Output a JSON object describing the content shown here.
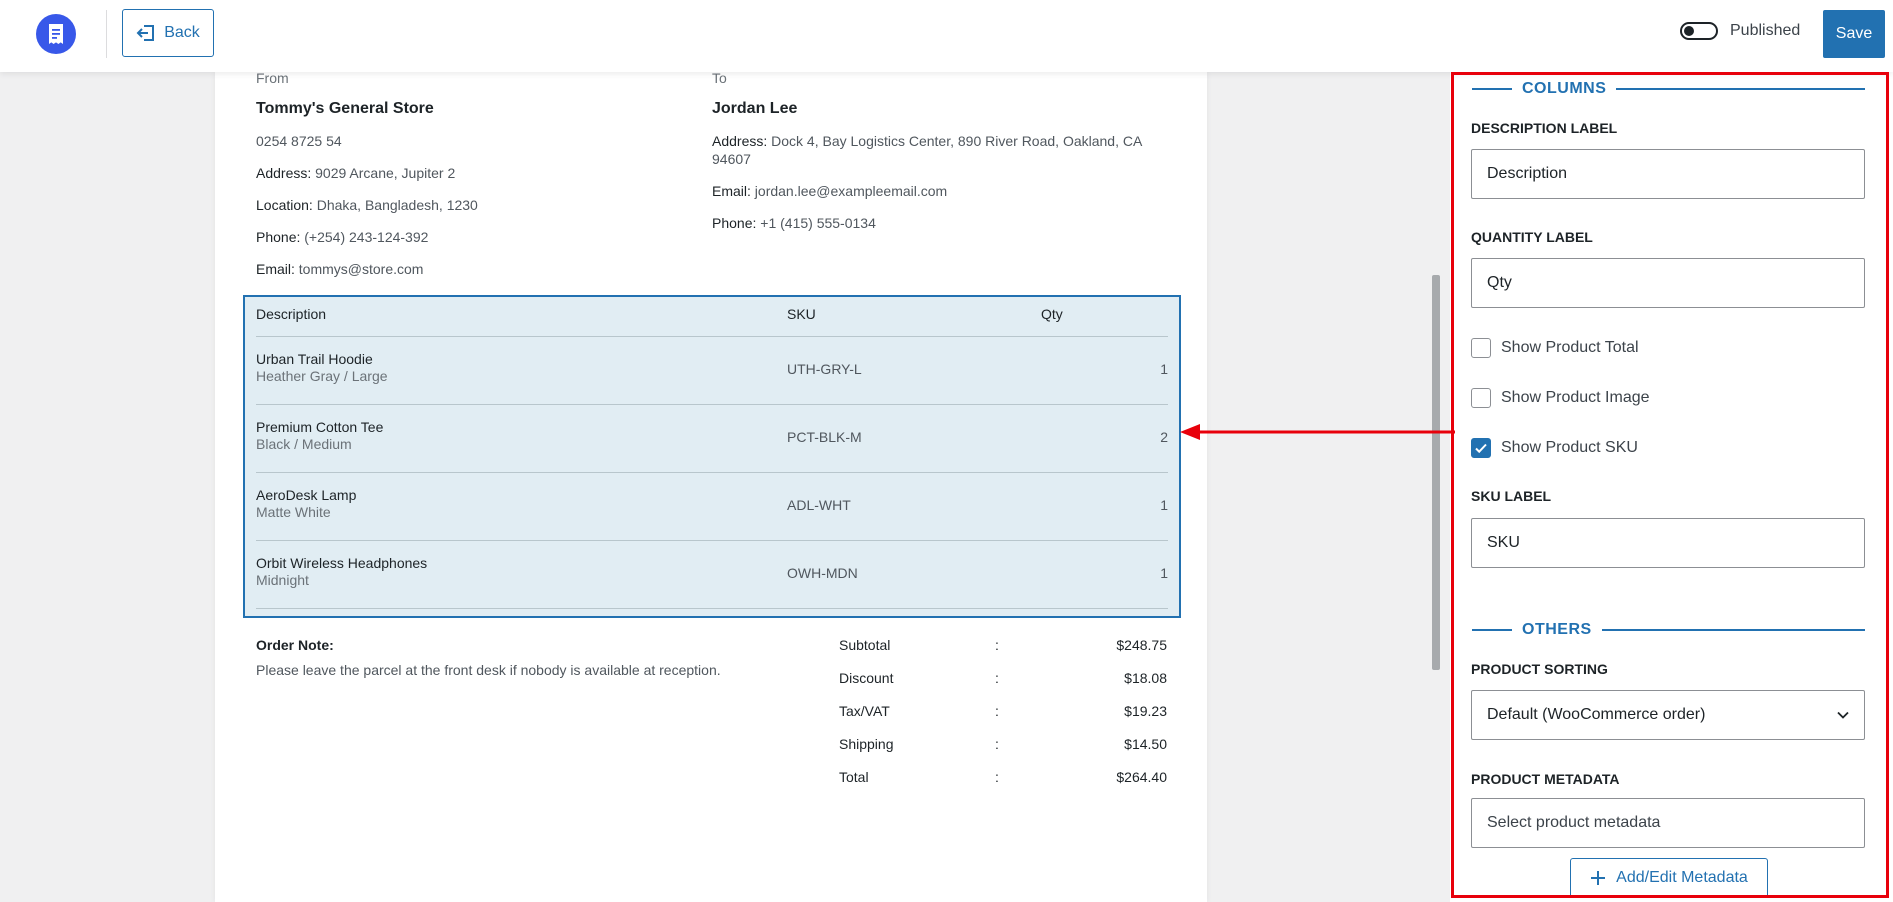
{
  "header": {
    "back_label": "Back",
    "published_label": "Published",
    "published_on": false,
    "save_label": "Save"
  },
  "invoice": {
    "from": {
      "label": "From",
      "name": "Tommy's General Store",
      "phone_plain": "0254 8725 54",
      "address_key": "Address:",
      "address": " 9029 Arcane, Jupiter 2",
      "location_key": "Location:",
      "location": " Dhaka, Bangladesh, 1230",
      "phone_key": "Phone:",
      "phone": " (+254) 243-124-392",
      "email_key": "Email:",
      "email": " tommys@store.com"
    },
    "to": {
      "label": "To",
      "name": "Jordan Lee",
      "address_key": "Address:",
      "address": " Dock 4, Bay Logistics Center, 890 River Road, Oakland, CA 94607",
      "email_key": "Email:",
      "email": " jordan.lee@exampleemail.com",
      "phone_key": "Phone:",
      "phone": " +1 (415) 555-0134"
    },
    "columns": [
      "Description",
      "SKU",
      "Qty"
    ],
    "items": [
      {
        "name": "Urban Trail Hoodie",
        "variant": "Heather Gray / Large",
        "sku": "UTH-GRY-L",
        "qty": "1"
      },
      {
        "name": "Premium Cotton Tee",
        "variant": "Black / Medium",
        "sku": "PCT-BLK-M",
        "qty": "2"
      },
      {
        "name": "AeroDesk Lamp",
        "variant": "Matte White",
        "sku": "ADL-WHT",
        "qty": "1"
      },
      {
        "name": "Orbit Wireless Headphones",
        "variant": "Midnight",
        "sku": "OWH-MDN",
        "qty": "1"
      }
    ],
    "note_title": "Order Note:",
    "note_text": "Please leave the parcel at the front desk if nobody is available at reception.",
    "totals": [
      {
        "label": "Subtotal",
        "sep": ":",
        "value": "$248.75"
      },
      {
        "label": "Discount",
        "sep": ":",
        "value": "$18.08"
      },
      {
        "label": "Tax/VAT",
        "sep": ":",
        "value": "$19.23"
      },
      {
        "label": "Shipping",
        "sep": ":",
        "value": "$14.50"
      },
      {
        "label": "Total",
        "sep": ":",
        "value": "$264.40"
      }
    ]
  },
  "panel": {
    "columns_title": "COLUMNS",
    "description_label_title": "DESCRIPTION LABEL",
    "description_label_value": "Description",
    "quantity_label_title": "QUANTITY LABEL",
    "quantity_label_value": "Qty",
    "show_total_label": "Show Product Total",
    "show_total_checked": false,
    "show_image_label": "Show Product Image",
    "show_image_checked": false,
    "show_sku_label": "Show Product SKU",
    "show_sku_checked": true,
    "sku_label_title": "SKU LABEL",
    "sku_label_value": "SKU",
    "others_title": "OTHERS",
    "sorting_title": "PRODUCT SORTING",
    "sorting_value": "Default (WooCommerce order)",
    "metadata_title": "PRODUCT METADATA",
    "metadata_placeholder": "Select product metadata",
    "metadata_button_label": "Add/Edit Metadata"
  },
  "colors": {
    "accent": "#2271b1",
    "annotation": "#e8000b",
    "logo": "#3858e9",
    "items_bg": "#e1edf3"
  },
  "icons": [
    "receipt-icon",
    "back-arrow-icon",
    "checkmark-icon",
    "chevron-down-icon",
    "plus-icon"
  ]
}
